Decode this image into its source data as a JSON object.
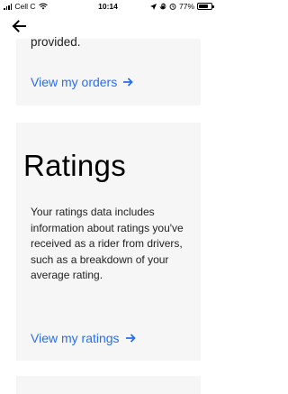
{
  "status_bar": {
    "carrier": "Cell C",
    "time": "10:14",
    "battery_percent": "77%",
    "battery_level": 0.77
  },
  "prev_section": {
    "text_tail": "provided.",
    "link_label": "View my orders"
  },
  "ratings": {
    "title": "Ratings",
    "description": "Your ratings data includes information about ratings you've received as a rider from drivers, such as a breakdown of your average rating.",
    "link_label": "View my ratings"
  },
  "colors": {
    "link": "#276ef1",
    "card_bg": "#f6f6f6"
  },
  "icons": {
    "back": "arrow-left-icon",
    "link_arrow": "arrow-right-icon"
  }
}
